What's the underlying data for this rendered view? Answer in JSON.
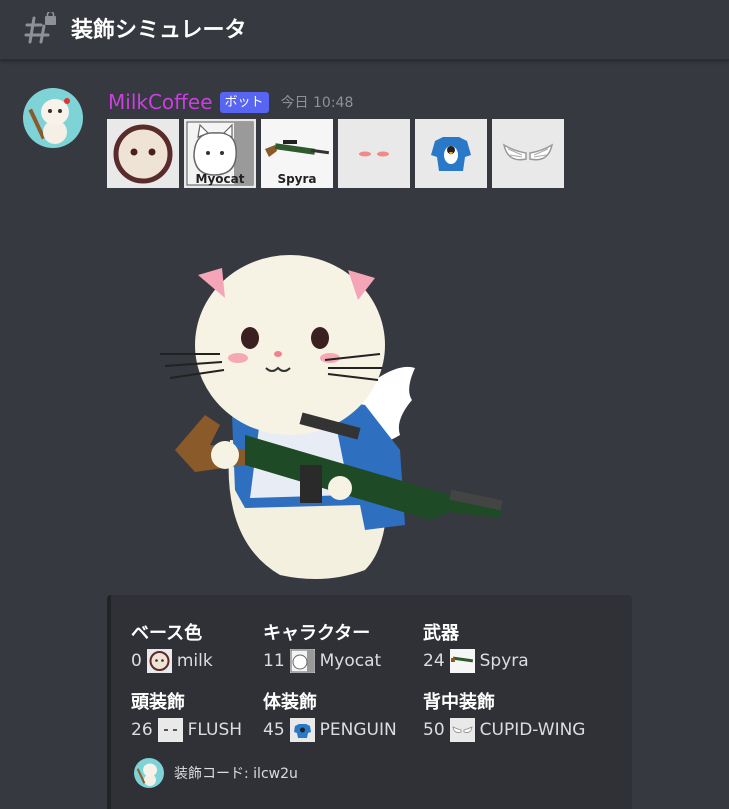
{
  "channel": {
    "name": "装飾シミュレータ",
    "icon": "hashtag-lock-icon"
  },
  "message": {
    "username": "MilkCoffee",
    "bot_tag": "ボット",
    "timestamp": "今日 10:48",
    "thumb_labels": [
      "",
      "Myocat",
      "Spyra",
      "",
      "",
      ""
    ]
  },
  "embed": {
    "fields": [
      {
        "title": "ベース色",
        "number": "0",
        "value": "milk"
      },
      {
        "title": "キャラクター",
        "number": "11",
        "value": "Myocat"
      },
      {
        "title": "武器",
        "number": "24",
        "value": "Spyra"
      },
      {
        "title": "頭装飾",
        "number": "26",
        "value": "FLUSH"
      },
      {
        "title": "体装飾",
        "number": "45",
        "value": "PENGUIN"
      },
      {
        "title": "背中装飾",
        "number": "50",
        "value": "CUPID-WING"
      }
    ],
    "footer": "装飾コード: ilcw2u"
  },
  "colors": {
    "background": "#36393f",
    "username": "#c93fe0",
    "bot_tag": "#5865f2",
    "embed_bg": "#2f3136"
  }
}
